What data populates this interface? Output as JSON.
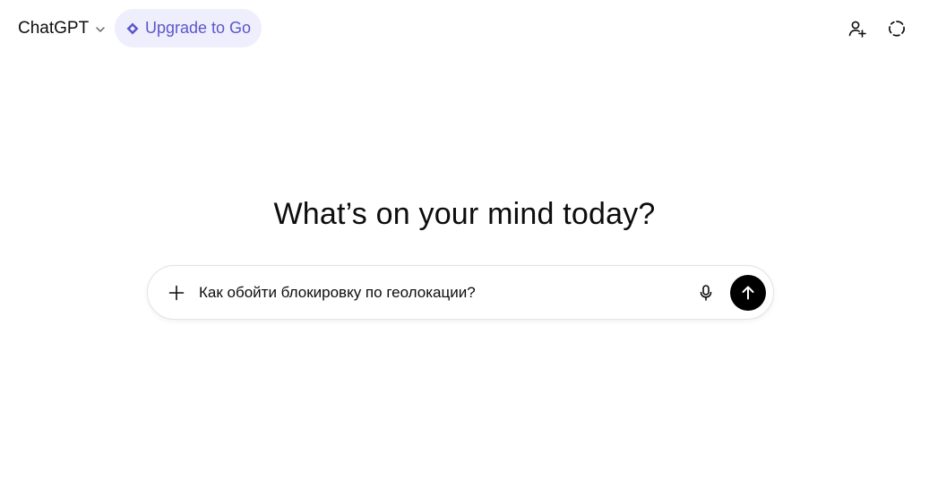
{
  "header": {
    "model_name": "ChatGPT",
    "upgrade_label": "Upgrade to Go",
    "icons": {
      "model_menu": "chevron-down-icon",
      "upgrade": "diamond-icon",
      "add_people": "add-person-icon",
      "temporary_chat": "dashed-circle-icon"
    }
  },
  "main": {
    "headline": "What’s on your mind today?"
  },
  "composer": {
    "value": "Как обойти блокировку по геолокации?",
    "icons": {
      "attach": "plus-icon",
      "voice": "microphone-icon",
      "send": "arrow-up-icon"
    }
  },
  "colors": {
    "upgrade_bg": "#eeeefd",
    "upgrade_text": "#5b57c9",
    "send_bg": "#000000",
    "text": "#0d0d0d"
  }
}
